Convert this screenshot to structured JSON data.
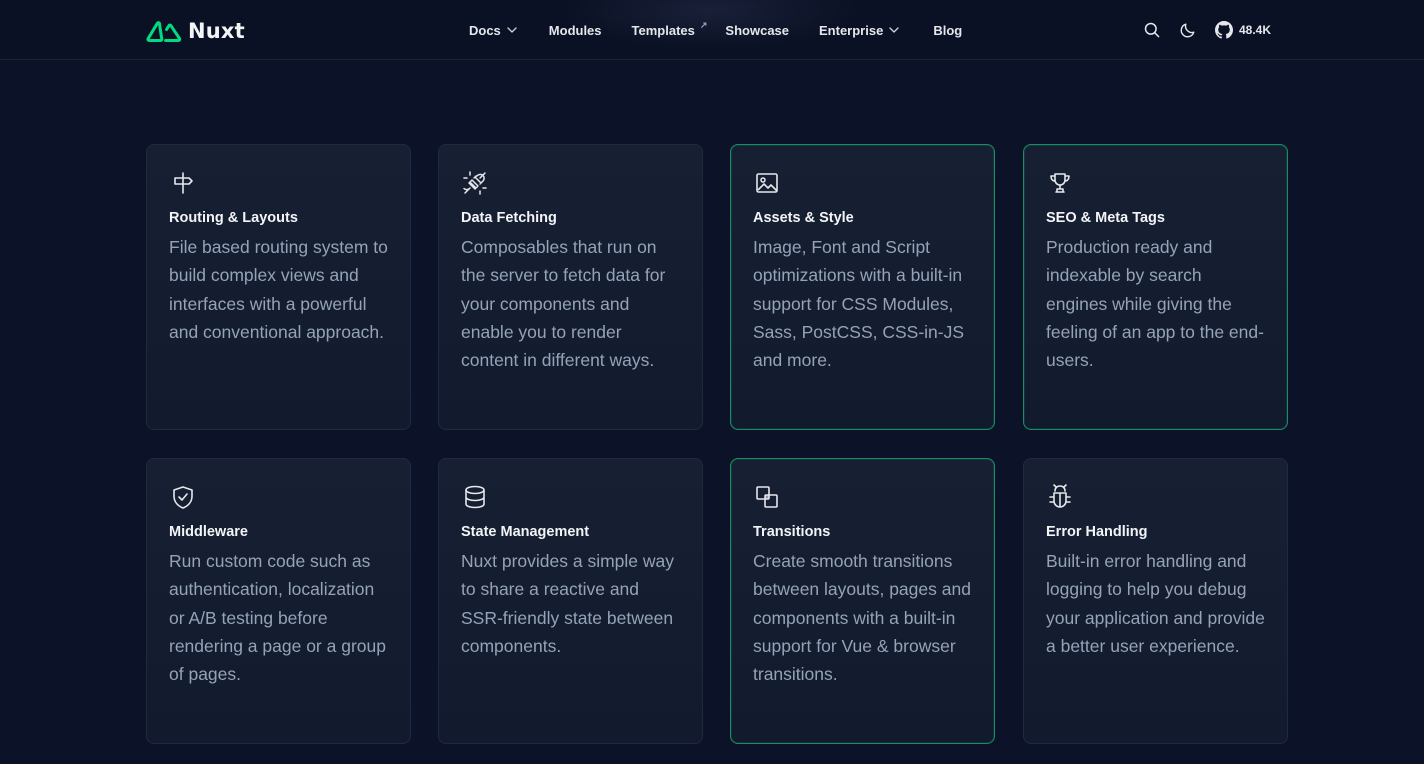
{
  "brand": {
    "name": "Nuxt",
    "accent": "#00DC82"
  },
  "nav": {
    "docs": "Docs",
    "modules": "Modules",
    "templates": "Templates",
    "showcase": "Showcase",
    "enterprise": "Enterprise",
    "blog": "Blog"
  },
  "header_actions": {
    "search_icon": "search-icon",
    "theme_icon": "moon-icon",
    "github_stars": "48.4K"
  },
  "features": [
    {
      "icon": "signpost-icon",
      "title": "Routing & Layouts",
      "description": "File based routing system to build complex views and interfaces with a powerful and conventional approach."
    },
    {
      "icon": "plug-icon",
      "title": "Data Fetching",
      "description": "Composables that run on the server to fetch data for your components and enable you to render content in different ways."
    },
    {
      "icon": "image-icon",
      "title": "Assets & Style",
      "description": "Image, Font and Script optimizations with a built-in support for CSS Modules, Sass, PostCSS, CSS-in-JS and more."
    },
    {
      "icon": "trophy-icon",
      "title": "SEO & Meta Tags",
      "description": "Production ready and indexable by search engines while giving the feeling of an app to the end-users."
    },
    {
      "icon": "shield-check-icon",
      "title": "Middleware",
      "description": "Run custom code such as authentication, localization or A/B testing before rendering a page or a group of pages."
    },
    {
      "icon": "database-icon",
      "title": "State Management",
      "description": "Nuxt provides a simple way to share a reactive and SSR-friendly state between components."
    },
    {
      "icon": "layers-icon",
      "title": "Transitions",
      "description": "Create smooth transitions between layouts, pages and components with a built-in support for Vue & browser transitions."
    },
    {
      "icon": "bug-icon",
      "title": "Error Handling",
      "description": "Built-in error handling and logging to help you debug your application and provide a better user experience."
    }
  ]
}
